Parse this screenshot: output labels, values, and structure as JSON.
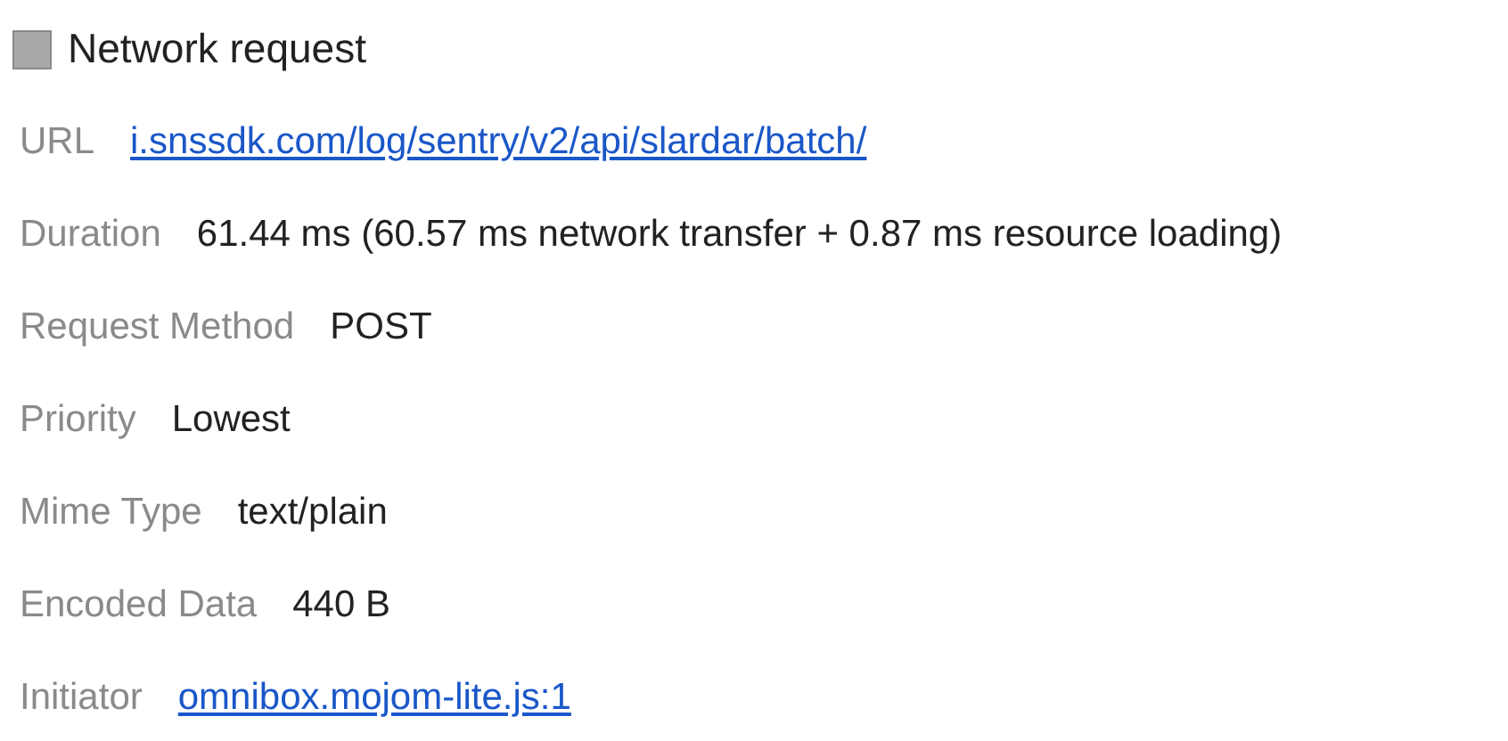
{
  "title": "Network request",
  "rows": [
    {
      "label": "URL",
      "value": "i.snssdk.com/log/sentry/v2/api/slardar/batch/",
      "kind": "link"
    },
    {
      "label": "Duration",
      "value": "61.44 ms (60.57 ms network transfer + 0.87 ms resource loading)",
      "kind": "text"
    },
    {
      "label": "Request Method",
      "value": "POST",
      "kind": "text"
    },
    {
      "label": "Priority",
      "value": "Lowest",
      "kind": "text"
    },
    {
      "label": "Mime Type",
      "value": "text/plain",
      "kind": "text"
    },
    {
      "label": "Encoded Data",
      "value": "440 B",
      "kind": "text"
    },
    {
      "label": "Initiator",
      "value": "omnibox.mojom-lite.js:1",
      "kind": "link"
    }
  ]
}
